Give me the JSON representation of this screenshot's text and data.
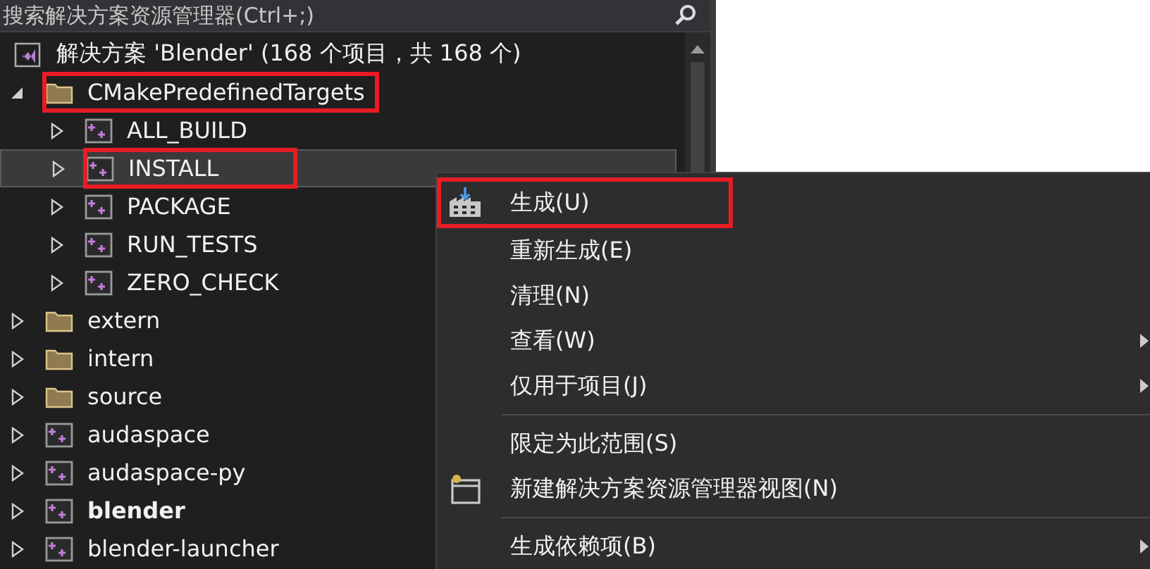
{
  "search": {
    "placeholder": "搜索解决方案资源管理器(Ctrl+;)"
  },
  "solution": {
    "label": "解决方案 'Blender' (168 个项目，共 168 个)",
    "children": [
      {
        "kind": "folder",
        "label": "CMakePredefinedTargets",
        "expanded": true,
        "selected": false,
        "bold": false,
        "annotated": true,
        "children": [
          {
            "kind": "project",
            "label": "ALL_BUILD",
            "expanded": false,
            "selected": false,
            "bold": false,
            "annotated": false
          },
          {
            "kind": "project",
            "label": "INSTALL",
            "expanded": false,
            "selected": true,
            "bold": false,
            "annotated": true
          },
          {
            "kind": "project",
            "label": "PACKAGE",
            "expanded": false,
            "selected": false,
            "bold": false,
            "annotated": false
          },
          {
            "kind": "project",
            "label": "RUN_TESTS",
            "expanded": false,
            "selected": false,
            "bold": false,
            "annotated": false
          },
          {
            "kind": "project",
            "label": "ZERO_CHECK",
            "expanded": false,
            "selected": false,
            "bold": false,
            "annotated": false
          }
        ]
      },
      {
        "kind": "folder",
        "label": "extern",
        "expanded": false,
        "selected": false,
        "bold": false,
        "annotated": false
      },
      {
        "kind": "folder",
        "label": "intern",
        "expanded": false,
        "selected": false,
        "bold": false,
        "annotated": false
      },
      {
        "kind": "folder",
        "label": "source",
        "expanded": false,
        "selected": false,
        "bold": false,
        "annotated": false
      },
      {
        "kind": "project",
        "label": "audaspace",
        "expanded": false,
        "selected": false,
        "bold": false,
        "annotated": false
      },
      {
        "kind": "project",
        "label": "audaspace-py",
        "expanded": false,
        "selected": false,
        "bold": false,
        "annotated": false
      },
      {
        "kind": "project",
        "label": "blender",
        "expanded": false,
        "selected": false,
        "bold": true,
        "annotated": false
      },
      {
        "kind": "project",
        "label": "blender-launcher",
        "expanded": false,
        "selected": false,
        "bold": false,
        "annotated": false
      }
    ]
  },
  "context_menu": [
    {
      "kind": "build",
      "label": "生成(U)",
      "submenu": false,
      "annotated": true
    },
    {
      "kind": "item",
      "label": "重新生成(E)",
      "submenu": false,
      "annotated": false
    },
    {
      "kind": "item",
      "label": "清理(N)",
      "submenu": false,
      "annotated": false
    },
    {
      "kind": "item",
      "label": "查看(W)",
      "submenu": true,
      "annotated": false
    },
    {
      "kind": "item",
      "label": "仅用于项目(J)",
      "submenu": true,
      "annotated": false
    },
    {
      "kind": "separator"
    },
    {
      "kind": "item",
      "label": "限定为此范围(S)",
      "submenu": false,
      "annotated": false
    },
    {
      "kind": "new_view",
      "label": "新建解决方案资源管理器视图(N)",
      "submenu": false,
      "annotated": false
    },
    {
      "kind": "separator"
    },
    {
      "kind": "item",
      "label": "生成依赖项(B)",
      "submenu": true,
      "annotated": false
    }
  ]
}
